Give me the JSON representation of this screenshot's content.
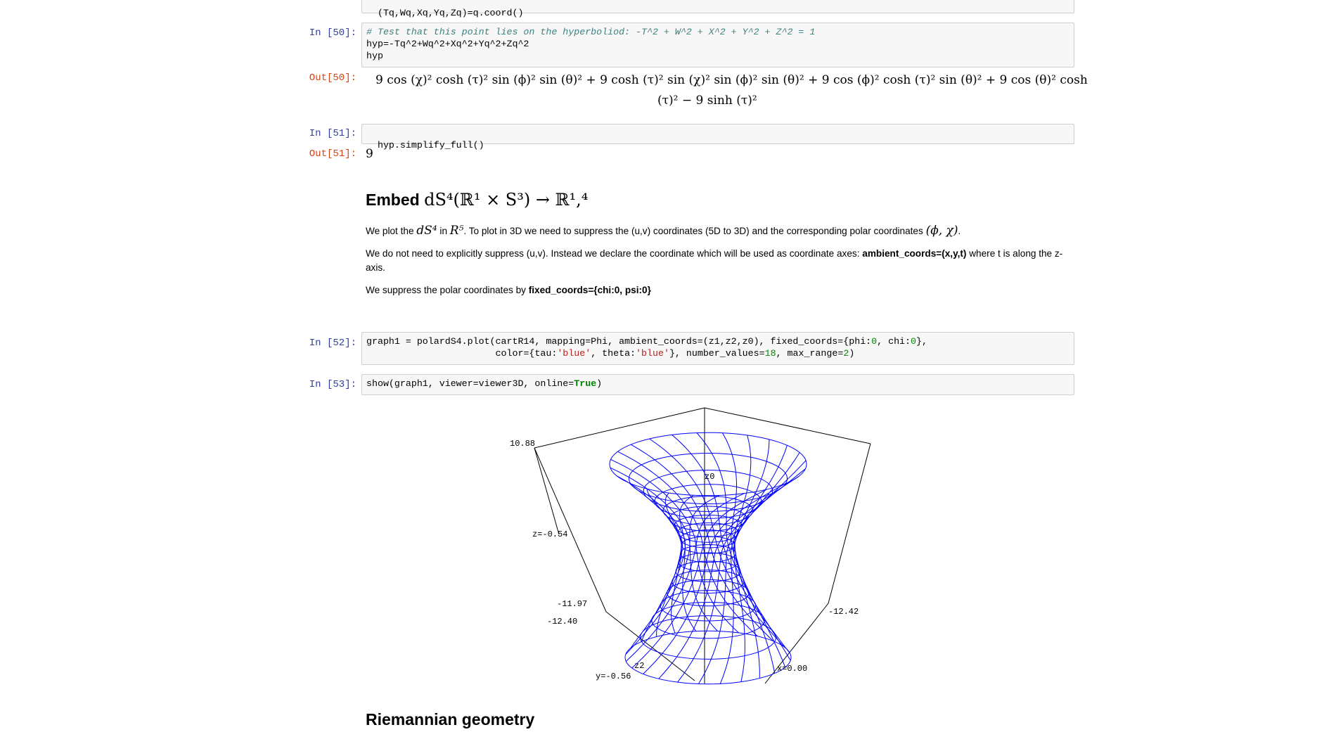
{
  "cell_top": {
    "code": "(Tq,Wq,Xq,Yq,Zq)=q.coord()"
  },
  "cell50": {
    "in_prompt": "In [50]:",
    "comment": "# Test that this point lies on the hyperboliod: -T^2 + W^2 + X^2 + Y^2 + Z^2 = 1",
    "line2": "hyp=-Tq^2+Wq^2+Xq^2+Yq^2+Zq^2",
    "line3": "hyp",
    "out_prompt": "Out[50]:",
    "out_line1": "9 cos (χ)² cosh (τ)² sin (ϕ)² sin (θ)² + 9 cosh (τ)² sin (χ)² sin (ϕ)² sin (θ)² + 9 cos (ϕ)² cosh (τ)² sin (θ)² + 9 cos (θ)² cosh",
    "out_line2": "(τ)² − 9 sinh (τ)²"
  },
  "cell51": {
    "in_prompt": "In [51]:",
    "code": "hyp.simplify_full()",
    "out_prompt": "Out[51]:",
    "out_value": "9"
  },
  "markdown": {
    "heading_word": "Embed",
    "heading_math": "dS⁴(ℝ¹ × S³) → ℝ¹,⁴",
    "p1_a": "We plot the ",
    "p1_m1": "dS⁴",
    "p1_b": " in ",
    "p1_m2": "R⁵",
    "p1_c": ". To plot in 3D we need to suppress the (u,v) coordinates (5D to 3D) and the corresponding polar coordinates ",
    "p1_m3": "(ϕ, χ)",
    "p1_d": ".",
    "p2_a": "We do not need to explicitly suppress (u,v). Instead we declare the coordinate which will be used as coordinate axes: ",
    "p2_bold": "ambient_coords=(x,y,t)",
    "p2_b": " where t is along the z-axis.",
    "p3_a": "We suppress the polar coordinates by ",
    "p3_bold": "fixed_coords={chi:0, psi:0}"
  },
  "cell52": {
    "in_prompt": "In [52]:",
    "l1_a": "graph1 = polardS4.plot(cartR14, mapping=Phi, ambient_coords=(z1,z2,z0), fixed_coords={phi:",
    "l1_n1": "0",
    "l1_b": ", chi:",
    "l1_n2": "0",
    "l1_c": "},",
    "l2_a": "                       color={tau:",
    "l2_s1": "'blue'",
    "l2_b": ", theta:",
    "l2_s2": "'blue'",
    "l2_c": "}, number_values=",
    "l2_n1": "18",
    "l2_d": ", max_range=",
    "l2_n2": "2",
    "l2_e": ")"
  },
  "cell53": {
    "in_prompt": "In [53]:",
    "code_a": "show(graph1, viewer=viewer3D, online=",
    "code_kw": "True",
    "code_b": ")"
  },
  "plot": {
    "labels": {
      "z_top": "10.88",
      "z0": "z0",
      "z_mid": "z=-0.54",
      "z_low1": "-11.97",
      "z_low2": "-12.40",
      "x_right": "-12.42",
      "z2": "z2",
      "y_label": "y=-0.56",
      "x_label": "x=0.00"
    },
    "surface_color": "#0000ff",
    "frame_color": "#000000"
  },
  "section2": {
    "heading": "Riemannian geometry"
  }
}
